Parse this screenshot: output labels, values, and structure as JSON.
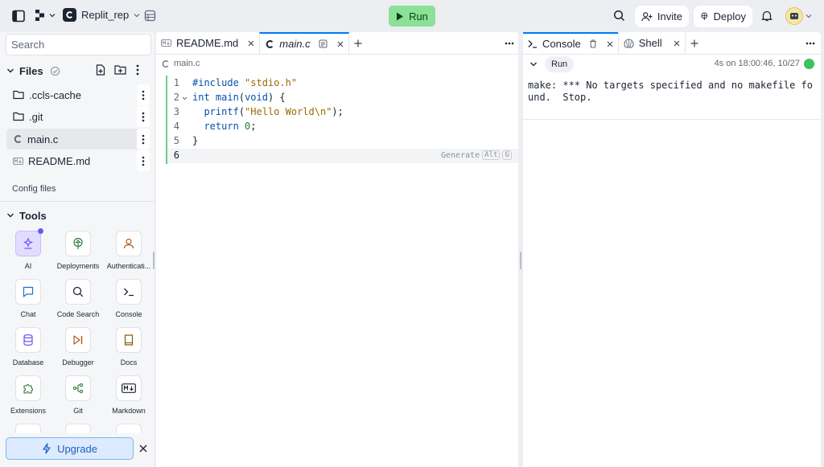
{
  "topbar": {
    "repl_name": "Replit_rep",
    "run_label": "Run",
    "invite_label": "Invite",
    "deploy_label": "Deploy"
  },
  "sidebar": {
    "search_placeholder": "Search",
    "files_title": "Files",
    "files": [
      {
        "name": ".ccls-cache",
        "icon": "folder-icon"
      },
      {
        "name": ".git",
        "icon": "folder-icon"
      },
      {
        "name": "main.c",
        "icon": "c-file-icon"
      },
      {
        "name": "README.md",
        "icon": "markdown-file-icon"
      }
    ],
    "config_files_label": "Config files",
    "tools_title": "Tools",
    "tools": [
      {
        "label": "AI",
        "icon": "ai-icon"
      },
      {
        "label": "Deployments",
        "icon": "deployments-icon"
      },
      {
        "label": "Authenticati...",
        "icon": "person-icon"
      },
      {
        "label": "Chat",
        "icon": "chat-icon"
      },
      {
        "label": "Code Search",
        "icon": "search-icon"
      },
      {
        "label": "Console",
        "icon": "terminal-icon"
      },
      {
        "label": "Database",
        "icon": "database-icon"
      },
      {
        "label": "Debugger",
        "icon": "debugger-icon"
      },
      {
        "label": "Docs",
        "icon": "book-icon"
      },
      {
        "label": "Extensions",
        "icon": "puzzle-icon"
      },
      {
        "label": "Git",
        "icon": "git-icon"
      },
      {
        "label": "Markdown",
        "icon": "markdown-icon"
      }
    ],
    "upgrade_label": "Upgrade"
  },
  "editor": {
    "tabs": [
      {
        "label": "README.md",
        "active": false
      },
      {
        "label": "main.c",
        "active": true
      }
    ],
    "breadcrumb": "main.c",
    "line_numbers": [
      "1",
      "2",
      "3",
      "4",
      "5",
      "6"
    ],
    "generate_label": "Generate",
    "generate_keys": [
      "Alt",
      "G"
    ]
  },
  "console": {
    "tabs": [
      {
        "label": "Console",
        "active": true
      },
      {
        "label": "Shell",
        "active": false
      }
    ],
    "run_chip": "Run",
    "timestamp": "4s on 18:00:46, 10/27",
    "status_color": "#3ac25b",
    "output_line1": "make: *** No targets specified and no makefile fo",
    "output_line2": "und.  Stop."
  },
  "colors": {
    "accent": "#0079f2",
    "run_green": "#8be196",
    "ai_purple": "#6b57f5"
  }
}
